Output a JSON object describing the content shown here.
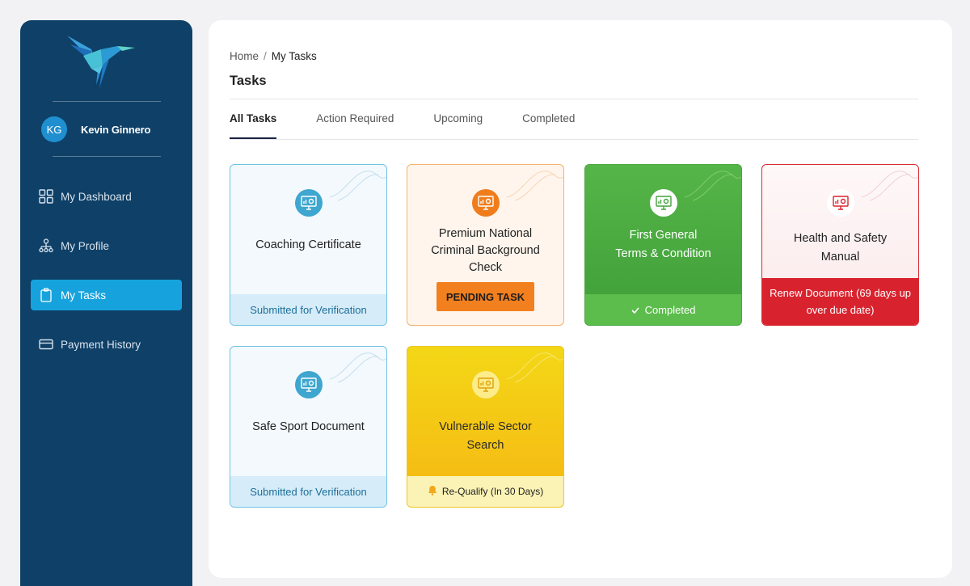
{
  "user": {
    "initials": "KG",
    "name": "Kevin Ginnero"
  },
  "nav": [
    {
      "label": "My Dashboard",
      "icon": "dashboard-icon"
    },
    {
      "label": "My Profile",
      "icon": "org-chart-icon"
    },
    {
      "label": "My Tasks",
      "icon": "clipboard-icon",
      "active": true
    },
    {
      "label": "Payment History",
      "icon": "credit-card-icon"
    }
  ],
  "breadcrumb": {
    "home": "Home",
    "separator": "/",
    "current": "My Tasks"
  },
  "page_title": "Tasks",
  "tabs": [
    {
      "label": "All Tasks",
      "active": true
    },
    {
      "label": "Action Required"
    },
    {
      "label": "Upcoming"
    },
    {
      "label": "Completed"
    }
  ],
  "cards": [
    {
      "title": "Coaching Certificate",
      "status": "Submitted for Verification",
      "variant": "blue"
    },
    {
      "title": "Premium National Criminal Background Check",
      "button": "PENDING TASK",
      "variant": "orange"
    },
    {
      "title_line1": "First General",
      "title_line2": "Terms & Condition",
      "status": "Completed",
      "status_icon": "check-icon",
      "variant": "green"
    },
    {
      "title_line1": "Health and Safety",
      "title_line2": "Manual",
      "status": "Renew Document (69 days up over due date)",
      "variant": "red"
    },
    {
      "title": "Safe Sport Document",
      "status": "Submitted for Verification",
      "variant": "blue"
    },
    {
      "title_line1": "Vulnerable Sector",
      "title_line2": "Search",
      "status": "Re-Qualify (In 30 Days)",
      "status_icon": "bell-icon",
      "variant": "yellow"
    }
  ],
  "colors": {
    "sidebar": "#0f4067",
    "active_nav": "#16a3dd",
    "blue_card": "#3ea6cf",
    "orange_card": "#f07d1c",
    "green_card": "#4ba842",
    "red_card": "#d8232e",
    "yellow_card": "#f3c515"
  }
}
